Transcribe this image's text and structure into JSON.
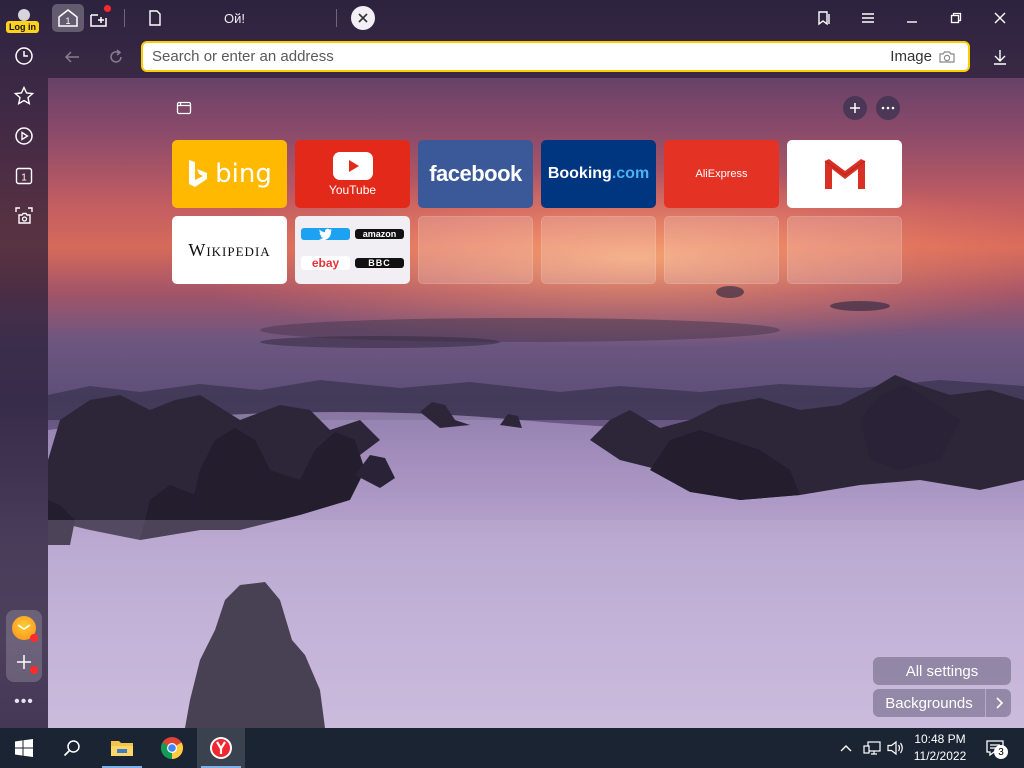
{
  "titlebar": {
    "login_badge": "Log in",
    "home_tab_number": "1",
    "active_tab_title": "Ой!"
  },
  "address_bar": {
    "placeholder": "Search or enter an address",
    "image_search_label": "Image"
  },
  "sidebar": {
    "tabs_count": "1",
    "more": "•••"
  },
  "tableau": {
    "tiles": [
      {
        "name": "bing",
        "label": "bing",
        "color": "#ffb900"
      },
      {
        "name": "youtube",
        "label": "YouTube",
        "color": "#e32a1a"
      },
      {
        "name": "facebook",
        "label": "facebook",
        "color": "#3b5998"
      },
      {
        "name": "booking",
        "label": "Booking",
        "suffix": ".com",
        "color": "#003580"
      },
      {
        "name": "aliexpress",
        "label": "AliExpress",
        "color": "#e43225"
      },
      {
        "name": "gmail",
        "label": "",
        "color": "#ffffff"
      },
      {
        "name": "wikipedia",
        "label": "Wikipedia",
        "color": "#ffffff"
      },
      {
        "name": "folder",
        "items": [
          "twitter",
          "amazon",
          "ebay",
          "BBC"
        ]
      }
    ],
    "folder_labels": {
      "amazon": "amazon",
      "ebay": "ebay",
      "bbc": "BBC"
    }
  },
  "buttons": {
    "all_settings": "All settings",
    "backgrounds": "Backgrounds"
  },
  "taskbar": {
    "time": "10:48 PM",
    "date": "11/2/2022",
    "notification_count": "3"
  },
  "colors": {
    "accent": "#ffcc00",
    "taskbar": "#1b2433",
    "badge": "#ffd21e"
  }
}
